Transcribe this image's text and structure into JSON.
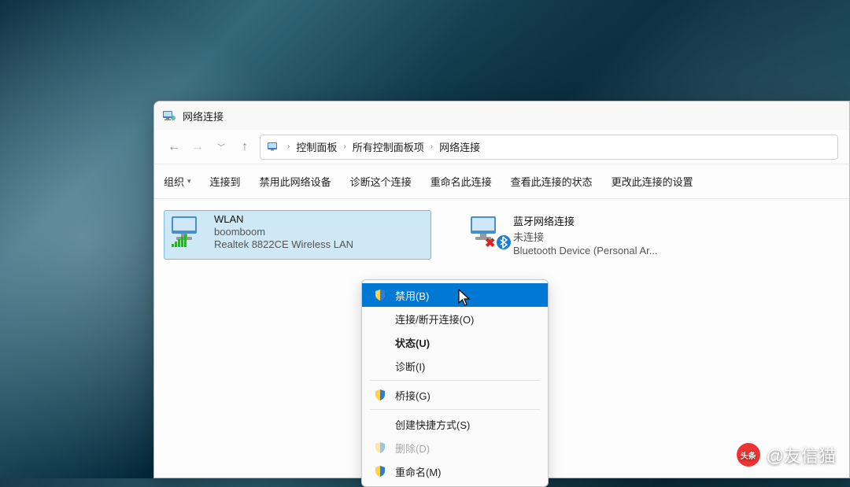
{
  "window": {
    "title": "网络连接"
  },
  "breadcrumb": {
    "items": [
      "控制面板",
      "所有控制面板项",
      "网络连接"
    ]
  },
  "toolbar": {
    "organize": "组织",
    "connect_to": "连接到",
    "disable": "禁用此网络设备",
    "diagnose": "诊断这个连接",
    "rename": "重命名此连接",
    "view_status": "查看此连接的状态",
    "change": "更改此连接的设置"
  },
  "connections": {
    "wlan": {
      "name": "WLAN",
      "status": "boomboom",
      "device": "Realtek 8822CE Wireless LAN"
    },
    "bluetooth": {
      "name": "蓝牙网络连接",
      "status": "未连接",
      "device": "Bluetooth Device (Personal Ar..."
    }
  },
  "context_menu": {
    "disable": "禁用(B)",
    "connect_disconnect": "连接/断开连接(O)",
    "status": "状态(U)",
    "diagnose": "诊断(I)",
    "bridge": "桥接(G)",
    "create_shortcut": "创建快捷方式(S)",
    "delete": "删除(D)",
    "rename": "重命名(M)"
  },
  "watermark": {
    "brand": "头条",
    "handle": "@友信猫"
  }
}
